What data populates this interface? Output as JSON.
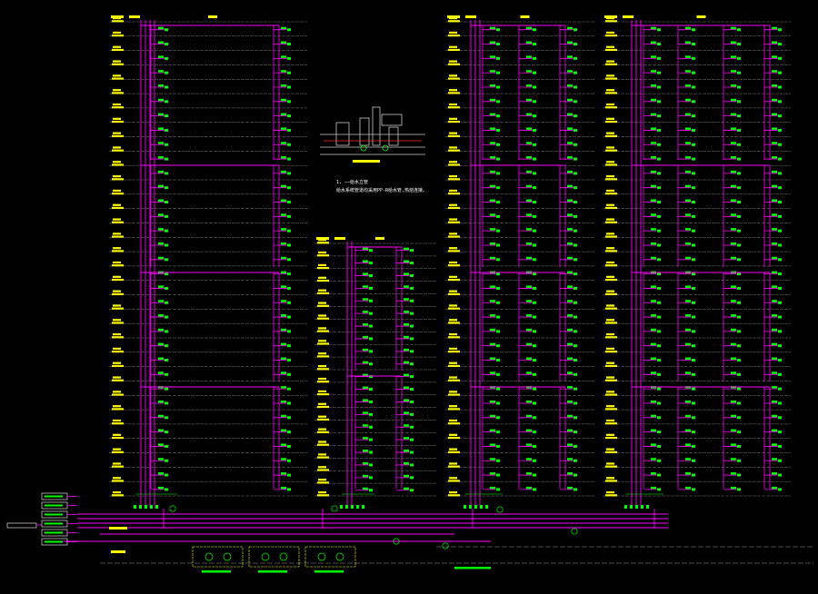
{
  "drawing": {
    "background": "#000000",
    "colors": {
      "floor_line": "#9a9a9a",
      "label": "#ffff00",
      "pipe": "#ff00ff",
      "fixture": "#00ff00",
      "note": "#ffffff",
      "detail": "#c8c8c8",
      "accent_red": "#ff3030"
    }
  },
  "towers": [
    {
      "id": "A",
      "floors": 33
    },
    {
      "id": "B",
      "floors": 20
    },
    {
      "id": "C",
      "floors": 33
    },
    {
      "id": "D",
      "floors": 33
    }
  ],
  "legend": {
    "note_1": "1. ——给水立管",
    "note_2": "给水系统管道均采用PP-R给水管,热熔连接。"
  }
}
